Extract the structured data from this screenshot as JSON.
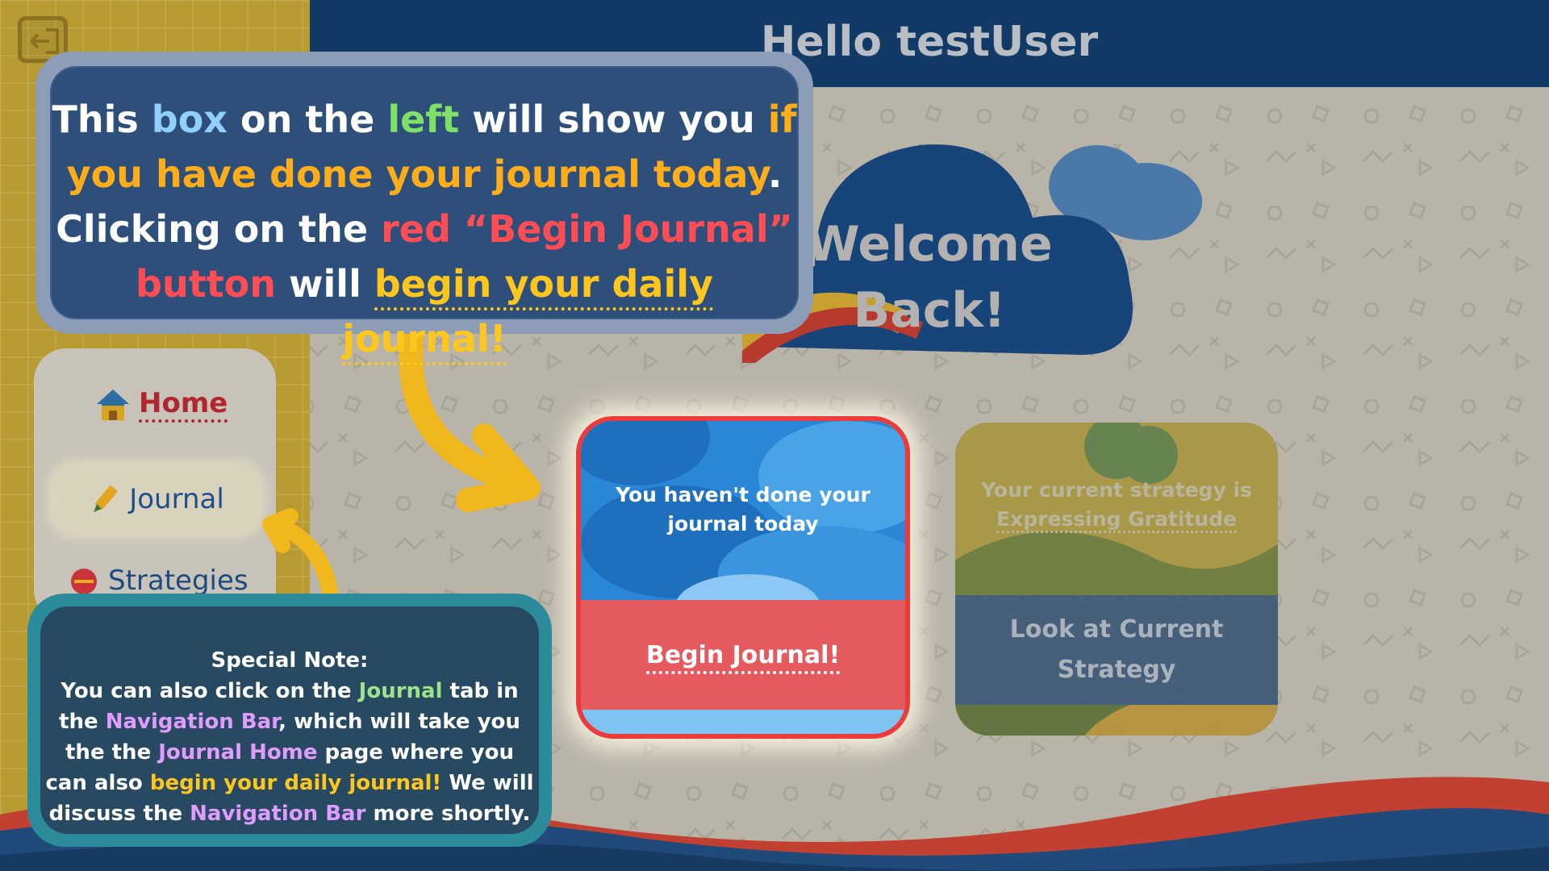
{
  "header": {
    "title": "Hello testUser"
  },
  "welcome": {
    "line1": "Welcome",
    "line2": "Back!"
  },
  "nav": {
    "items": [
      {
        "label": "Home"
      },
      {
        "label": "Journal"
      },
      {
        "label": "Strategies"
      }
    ]
  },
  "journal_card": {
    "status_line1": "You haven't done your",
    "status_line2": "journal today",
    "button_label": "Begin Journal!"
  },
  "strategy_card": {
    "line1": "Your current strategy is",
    "line2": "Expressing Gratitude",
    "button_line1": "Look at Current",
    "button_line2": "Strategy"
  },
  "tutorial": {
    "t1": "This ",
    "t2": "box",
    "t3": " on the ",
    "t4": "left",
    "t5": " will show you ",
    "t6": "if",
    "t7": "you have done your journal today",
    "t8": ".",
    "t9": "Clicking on the ",
    "t10": "red “Begin Journal”",
    "t11": "button",
    "t12": " will ",
    "t13": "begin your daily journal!"
  },
  "note": {
    "title": "Special Note:",
    "n1": "You can also click on the ",
    "n2": "Journal",
    "n3": " tab in",
    "n4": "the ",
    "n5": "Navigation Bar",
    "n6": ", which will take you",
    "n7": "the the ",
    "n8": "Journal Home",
    "n9": " page where you",
    "n10": "can also ",
    "n11": "begin your daily journal!",
    "n12": " We will",
    "n13": "discuss the ",
    "n14": "Navigation Bar",
    "n15": " more shortly."
  },
  "icons": {
    "logout": "logout-icon",
    "home": "house-icon",
    "journal": "pencil-icon",
    "strategies": "strategy-icon"
  },
  "colors": {
    "header": "#123a66",
    "sidebar": "#b89a33",
    "highlight_red": "#ec3b3b",
    "tooltip": "#2e4f7a",
    "note": "#274a62"
  }
}
